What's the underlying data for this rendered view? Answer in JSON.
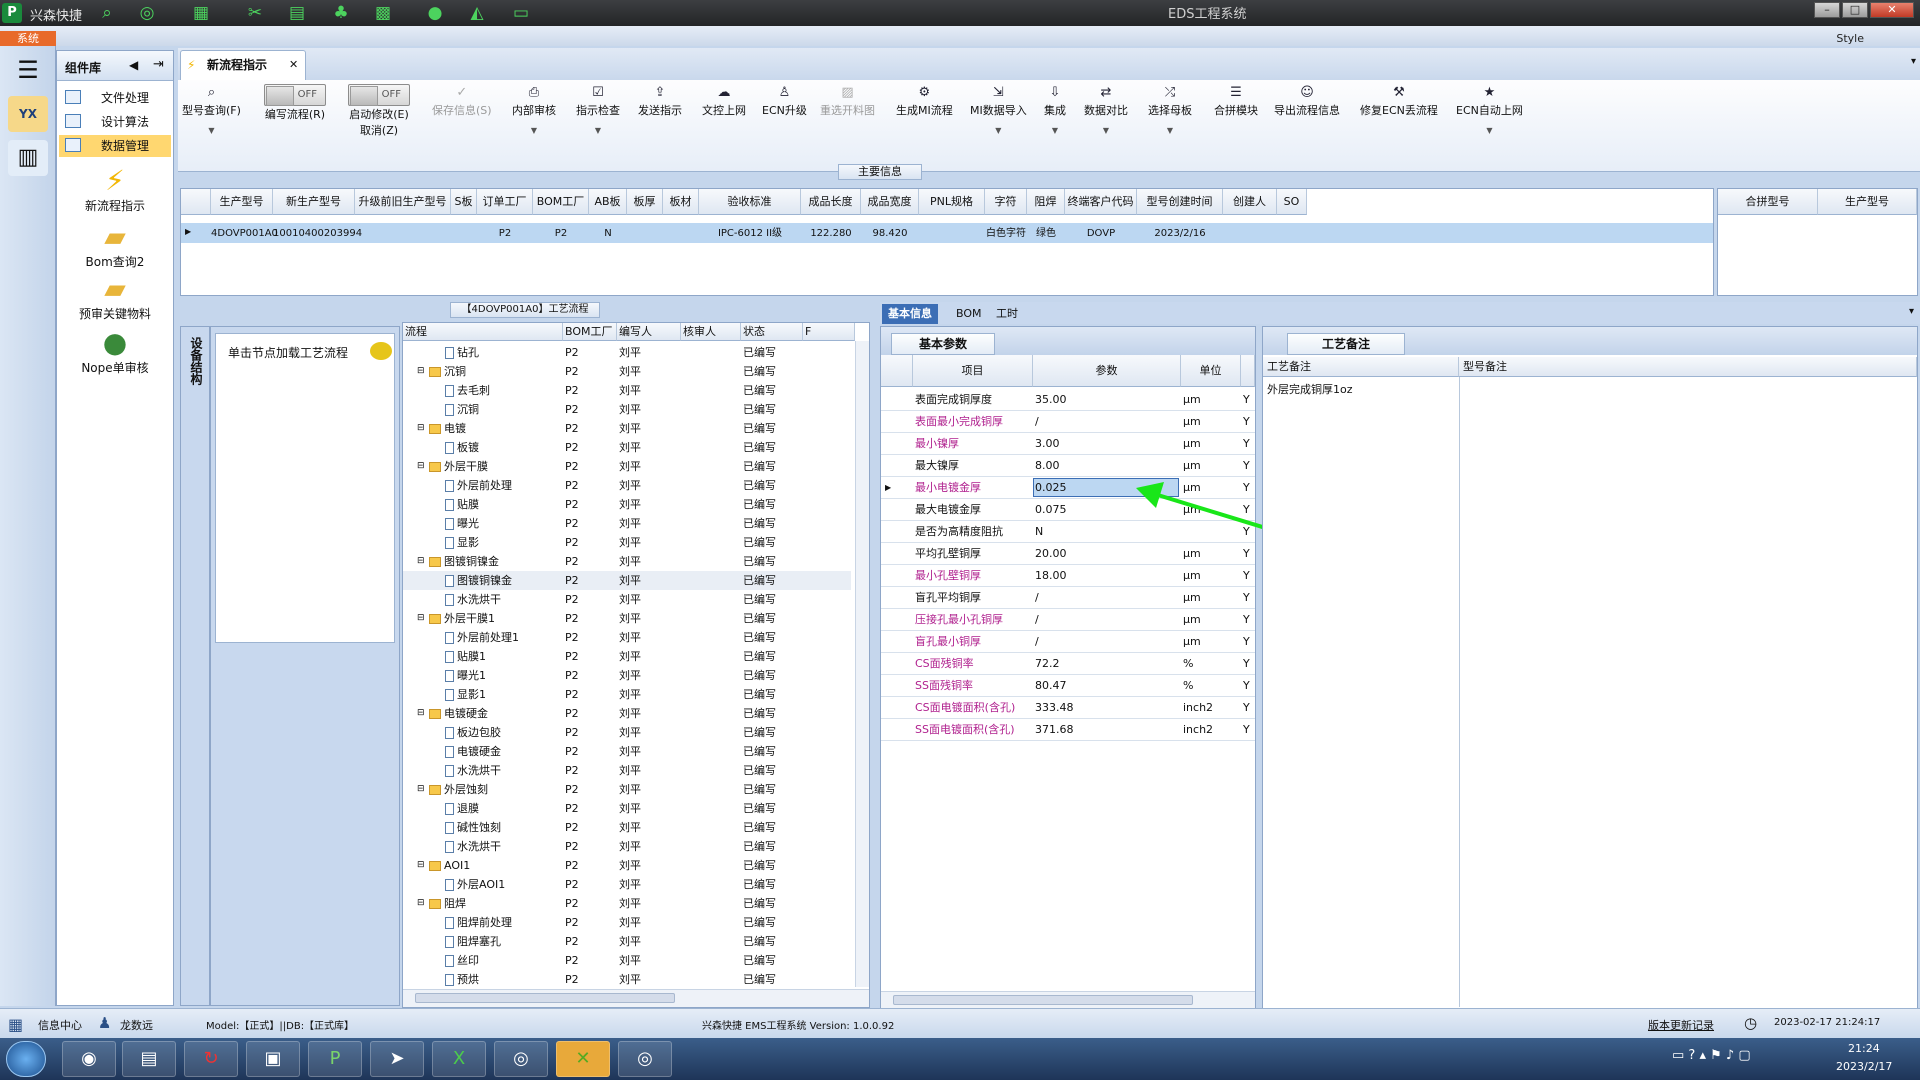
{
  "app": {
    "name": "兴森快捷",
    "window_title": "EDS工程系统",
    "system_tab": "系统",
    "style_label": "Style"
  },
  "complib": {
    "title": "组件库",
    "items": [
      "文件处理",
      "设计算法",
      "数据管理"
    ],
    "tools": [
      "新流程指示",
      "Bom查询2",
      "预审关键物料",
      "Nope单审核"
    ]
  },
  "doc_tab": "新流程指示",
  "ribbon": [
    {
      "label": "型号查询(F)",
      "icon": "search-icon"
    },
    {
      "label": "编写流程(R)",
      "toggle": "OFF"
    },
    {
      "label": "启动修改(E)",
      "sub": "取消(Z)",
      "toggle": "OFF"
    },
    {
      "label": "保存信息(S)",
      "icon": "check-icon"
    },
    {
      "label": "内部审核",
      "icon": "print-icon"
    },
    {
      "label": "指示检查",
      "icon": "checkbox-icon"
    },
    {
      "label": "发送指示",
      "icon": "upload-icon"
    },
    {
      "label": "文控上网",
      "icon": "cloud-icon"
    },
    {
      "label": "ECN升级",
      "icon": "person-icon"
    },
    {
      "label": "重选开料图",
      "icon": "image-icon"
    },
    {
      "label": "生成MI流程",
      "icon": "gears-icon"
    },
    {
      "label": "MI数据导入",
      "icon": "import-icon"
    },
    {
      "label": "集成",
      "icon": "download-icon"
    },
    {
      "label": "数据对比",
      "icon": "compare-icon"
    },
    {
      "label": "选择母板",
      "icon": "shuffle-icon"
    },
    {
      "label": "合拼模块",
      "icon": "list-icon"
    },
    {
      "label": "导出流程信息",
      "icon": "smile-icon"
    },
    {
      "label": "修复ECN丢流程",
      "icon": "wrench-icon"
    },
    {
      "label": "ECN自动上网",
      "icon": "star-icon"
    }
  ],
  "main_info": {
    "title": "主要信息",
    "columns": [
      "生产型号",
      "新生产型号",
      "升级前旧生产型号",
      "S板",
      "订单工厂",
      "BOM工厂",
      "AB板",
      "板厚",
      "板材",
      "验收标准",
      "成品长度",
      "成品宽度",
      "PNL规格",
      "字符",
      "阻焊",
      "终端客户代码",
      "型号创建时间",
      "创建人",
      "SO"
    ],
    "row": [
      "4DOVP001A0",
      "10010400203994",
      "",
      "",
      "P2",
      "P2",
      "N",
      "",
      "",
      "IPC-6012 II级",
      "122.280",
      "98.420",
      "",
      "白色字符",
      "绿色",
      "DOVP",
      "2023/2/16",
      "",
      ""
    ],
    "right_columns": [
      "合拼型号",
      "生产型号"
    ]
  },
  "node_panel": {
    "vertical_label": "设备结构",
    "hint": "单击节点加载工艺流程"
  },
  "flow": {
    "title": "【4DOVP001A0】工艺流程",
    "columns": [
      "流程",
      "BOM工厂",
      "编写人",
      "核审人",
      "状态",
      "F"
    ],
    "rows": [
      {
        "name": "钻孔",
        "level": 2,
        "folder": false
      },
      {
        "name": "沉铜",
        "level": 1,
        "folder": true
      },
      {
        "name": "去毛刺",
        "level": 2,
        "folder": false
      },
      {
        "name": "沉铜",
        "level": 2,
        "folder": false
      },
      {
        "name": "电镀",
        "level": 1,
        "folder": true
      },
      {
        "name": "板镀",
        "level": 2,
        "folder": false
      },
      {
        "name": "外层干膜",
        "level": 1,
        "folder": true
      },
      {
        "name": "外层前处理",
        "level": 2,
        "folder": false
      },
      {
        "name": "贴膜",
        "level": 2,
        "folder": false
      },
      {
        "name": "曝光",
        "level": 2,
        "folder": false
      },
      {
        "name": "显影",
        "level": 2,
        "folder": false
      },
      {
        "name": "图镀铜镍金",
        "level": 1,
        "folder": true
      },
      {
        "name": "图镀铜镍金",
        "level": 2,
        "folder": false
      },
      {
        "name": "水洗烘干",
        "level": 2,
        "folder": false
      },
      {
        "name": "外层干膜1",
        "level": 1,
        "folder": true
      },
      {
        "name": "外层前处理1",
        "level": 2,
        "folder": false
      },
      {
        "name": "贴膜1",
        "level": 2,
        "folder": false
      },
      {
        "name": "曝光1",
        "level": 2,
        "folder": false
      },
      {
        "name": "显影1",
        "level": 2,
        "folder": false
      },
      {
        "name": "电镀硬金",
        "level": 1,
        "folder": true
      },
      {
        "name": "板边包胶",
        "level": 2,
        "folder": false
      },
      {
        "name": "电镀硬金",
        "level": 2,
        "folder": false
      },
      {
        "name": "水洗烘干",
        "level": 2,
        "folder": false
      },
      {
        "name": "外层蚀刻",
        "level": 1,
        "folder": true
      },
      {
        "name": "退膜",
        "level": 2,
        "folder": false
      },
      {
        "name": "碱性蚀刻",
        "level": 2,
        "folder": false
      },
      {
        "name": "水洗烘干",
        "level": 2,
        "folder": false
      },
      {
        "name": "AOI1",
        "level": 1,
        "folder": true
      },
      {
        "name": "外层AOI1",
        "level": 2,
        "folder": false
      },
      {
        "name": "阻焊",
        "level": 1,
        "folder": true
      },
      {
        "name": "阻焊前处理",
        "level": 2,
        "folder": false
      },
      {
        "name": "阻焊塞孔",
        "level": 2,
        "folder": false
      },
      {
        "name": "丝印",
        "level": 2,
        "folder": false
      },
      {
        "name": "预烘",
        "level": 2,
        "folder": false
      }
    ],
    "bom_factory": "P2",
    "writer": "刘平",
    "status": "已编写"
  },
  "info_tabs": [
    "基本信息",
    "BOM",
    "工时"
  ],
  "params": {
    "title": "基本参数",
    "columns": [
      "项目",
      "参数",
      "单位"
    ],
    "rows": [
      {
        "item": "表面完成铜厚度",
        "value": "35.00",
        "unit": "μm",
        "flag": "Y",
        "mag": false
      },
      {
        "item": "表面最小完成铜厚",
        "value": "/",
        "unit": "μm",
        "flag": "Y",
        "mag": true
      },
      {
        "item": "最小镍厚",
        "value": "3.00",
        "unit": "μm",
        "flag": "Y",
        "mag": true
      },
      {
        "item": "最大镍厚",
        "value": "8.00",
        "unit": "μm",
        "flag": "Y",
        "mag": false
      },
      {
        "item": "最小电镀金厚",
        "value": "0.025",
        "unit": "μm",
        "flag": "Y",
        "mag": true
      },
      {
        "item": "最大电镀金厚",
        "value": "0.075",
        "unit": "μm",
        "flag": "Y",
        "mag": false
      },
      {
        "item": "是否为高精度阻抗",
        "value": "N",
        "unit": "",
        "flag": "Y",
        "mag": false
      },
      {
        "item": "平均孔壁铜厚",
        "value": "20.00",
        "unit": "μm",
        "flag": "Y",
        "mag": false
      },
      {
        "item": "最小孔壁铜厚",
        "value": "18.00",
        "unit": "μm",
        "flag": "Y",
        "mag": true
      },
      {
        "item": "盲孔平均铜厚",
        "value": "/",
        "unit": "μm",
        "flag": "Y",
        "mag": false
      },
      {
        "item": "压接孔最小孔铜厚",
        "value": "/",
        "unit": "μm",
        "flag": "Y",
        "mag": true
      },
      {
        "item": "盲孔最小铜厚",
        "value": "/",
        "unit": "μm",
        "flag": "Y",
        "mag": true
      },
      {
        "item": "CS面残铜率",
        "value": "72.2",
        "unit": "%",
        "flag": "Y",
        "mag": true
      },
      {
        "item": "SS面残铜率",
        "value": "80.47",
        "unit": "%",
        "flag": "Y",
        "mag": true
      },
      {
        "item": "CS面电镀面积(含孔)",
        "value": "333.48",
        "unit": "inch2",
        "flag": "Y",
        "mag": true
      },
      {
        "item": "SS面电镀面积(含孔)",
        "value": "371.68",
        "unit": "inch2",
        "flag": "Y",
        "mag": true
      }
    ]
  },
  "memo": {
    "title": "工艺备注",
    "col1": "工艺备注",
    "col2": "型号备注",
    "note": "外层完成铜厚1oz"
  },
  "statusbar": {
    "info_center": "信息中心",
    "user": "龙数远",
    "model": "Model:【正式】||DB:【正式库】",
    "version": "兴森快捷 EMS工程系统 Version: 1.0.0.92",
    "update_log": "版本更新记录",
    "datetime": "2023-02-17 21:24:17"
  },
  "taskbar": {
    "time": "21:24",
    "date": "2023/2/17"
  },
  "colors": {
    "accent": "#3c6eb5",
    "selection": "#bcd7f2",
    "arrow": "#19e619",
    "magenta": "#b0208e"
  }
}
